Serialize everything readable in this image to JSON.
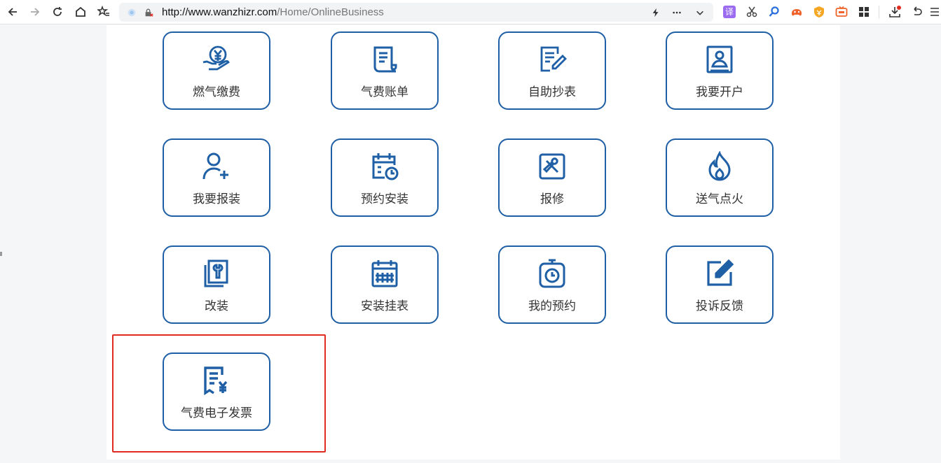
{
  "browser": {
    "url_host": "http://www.wanzhizr.com",
    "url_path": "/Home/OnlineBusiness",
    "nav_icons": [
      "back-icon",
      "forward-icon",
      "reload-icon",
      "home-icon",
      "favorites-icon"
    ],
    "ext_icons": [
      "translate-icon",
      "scissors-icon",
      "search-icon",
      "game-icon",
      "shield-icon",
      "tv-icon",
      "apps-icon",
      "download-icon",
      "undo-icon",
      "menu-icon"
    ],
    "translate_label": "译"
  },
  "services": [
    {
      "label": "燃气缴费",
      "icon": "yen-hand-icon"
    },
    {
      "label": "气费账单",
      "icon": "bill-icon"
    },
    {
      "label": "自助抄表",
      "icon": "meter-read-icon"
    },
    {
      "label": "我要开户",
      "icon": "account-icon"
    },
    {
      "label": "我要报装",
      "icon": "add-user-icon"
    },
    {
      "label": "预约安装",
      "icon": "calendar-clock-icon"
    },
    {
      "label": "报修",
      "icon": "repair-icon"
    },
    {
      "label": "送气点火",
      "icon": "flame-icon"
    },
    {
      "label": "改装",
      "icon": "wrench-book-icon"
    },
    {
      "label": "安装挂表",
      "icon": "calendar-grid-icon"
    },
    {
      "label": "我的预约",
      "icon": "stopwatch-icon"
    },
    {
      "label": "投诉反馈",
      "icon": "edit-icon"
    },
    {
      "label": "气费电子发票",
      "icon": "invoice-icon"
    }
  ],
  "colors": {
    "accent": "#1f5fa5",
    "highlight": "#e12b20"
  }
}
